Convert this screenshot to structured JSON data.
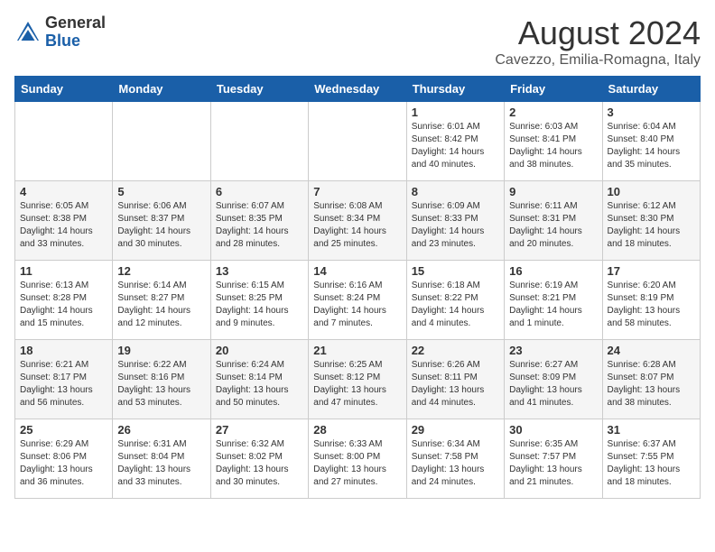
{
  "header": {
    "logo_general": "General",
    "logo_blue": "Blue",
    "month_year": "August 2024",
    "location": "Cavezzo, Emilia-Romagna, Italy"
  },
  "days_of_week": [
    "Sunday",
    "Monday",
    "Tuesday",
    "Wednesday",
    "Thursday",
    "Friday",
    "Saturday"
  ],
  "weeks": [
    [
      {
        "day": "",
        "info": ""
      },
      {
        "day": "",
        "info": ""
      },
      {
        "day": "",
        "info": ""
      },
      {
        "day": "",
        "info": ""
      },
      {
        "day": "1",
        "info": "Sunrise: 6:01 AM\nSunset: 8:42 PM\nDaylight: 14 hours\nand 40 minutes."
      },
      {
        "day": "2",
        "info": "Sunrise: 6:03 AM\nSunset: 8:41 PM\nDaylight: 14 hours\nand 38 minutes."
      },
      {
        "day": "3",
        "info": "Sunrise: 6:04 AM\nSunset: 8:40 PM\nDaylight: 14 hours\nand 35 minutes."
      }
    ],
    [
      {
        "day": "4",
        "info": "Sunrise: 6:05 AM\nSunset: 8:38 PM\nDaylight: 14 hours\nand 33 minutes."
      },
      {
        "day": "5",
        "info": "Sunrise: 6:06 AM\nSunset: 8:37 PM\nDaylight: 14 hours\nand 30 minutes."
      },
      {
        "day": "6",
        "info": "Sunrise: 6:07 AM\nSunset: 8:35 PM\nDaylight: 14 hours\nand 28 minutes."
      },
      {
        "day": "7",
        "info": "Sunrise: 6:08 AM\nSunset: 8:34 PM\nDaylight: 14 hours\nand 25 minutes."
      },
      {
        "day": "8",
        "info": "Sunrise: 6:09 AM\nSunset: 8:33 PM\nDaylight: 14 hours\nand 23 minutes."
      },
      {
        "day": "9",
        "info": "Sunrise: 6:11 AM\nSunset: 8:31 PM\nDaylight: 14 hours\nand 20 minutes."
      },
      {
        "day": "10",
        "info": "Sunrise: 6:12 AM\nSunset: 8:30 PM\nDaylight: 14 hours\nand 18 minutes."
      }
    ],
    [
      {
        "day": "11",
        "info": "Sunrise: 6:13 AM\nSunset: 8:28 PM\nDaylight: 14 hours\nand 15 minutes."
      },
      {
        "day": "12",
        "info": "Sunrise: 6:14 AM\nSunset: 8:27 PM\nDaylight: 14 hours\nand 12 minutes."
      },
      {
        "day": "13",
        "info": "Sunrise: 6:15 AM\nSunset: 8:25 PM\nDaylight: 14 hours\nand 9 minutes."
      },
      {
        "day": "14",
        "info": "Sunrise: 6:16 AM\nSunset: 8:24 PM\nDaylight: 14 hours\nand 7 minutes."
      },
      {
        "day": "15",
        "info": "Sunrise: 6:18 AM\nSunset: 8:22 PM\nDaylight: 14 hours\nand 4 minutes."
      },
      {
        "day": "16",
        "info": "Sunrise: 6:19 AM\nSunset: 8:21 PM\nDaylight: 14 hours\nand 1 minute."
      },
      {
        "day": "17",
        "info": "Sunrise: 6:20 AM\nSunset: 8:19 PM\nDaylight: 13 hours\nand 58 minutes."
      }
    ],
    [
      {
        "day": "18",
        "info": "Sunrise: 6:21 AM\nSunset: 8:17 PM\nDaylight: 13 hours\nand 56 minutes."
      },
      {
        "day": "19",
        "info": "Sunrise: 6:22 AM\nSunset: 8:16 PM\nDaylight: 13 hours\nand 53 minutes."
      },
      {
        "day": "20",
        "info": "Sunrise: 6:24 AM\nSunset: 8:14 PM\nDaylight: 13 hours\nand 50 minutes."
      },
      {
        "day": "21",
        "info": "Sunrise: 6:25 AM\nSunset: 8:12 PM\nDaylight: 13 hours\nand 47 minutes."
      },
      {
        "day": "22",
        "info": "Sunrise: 6:26 AM\nSunset: 8:11 PM\nDaylight: 13 hours\nand 44 minutes."
      },
      {
        "day": "23",
        "info": "Sunrise: 6:27 AM\nSunset: 8:09 PM\nDaylight: 13 hours\nand 41 minutes."
      },
      {
        "day": "24",
        "info": "Sunrise: 6:28 AM\nSunset: 8:07 PM\nDaylight: 13 hours\nand 38 minutes."
      }
    ],
    [
      {
        "day": "25",
        "info": "Sunrise: 6:29 AM\nSunset: 8:06 PM\nDaylight: 13 hours\nand 36 minutes."
      },
      {
        "day": "26",
        "info": "Sunrise: 6:31 AM\nSunset: 8:04 PM\nDaylight: 13 hours\nand 33 minutes."
      },
      {
        "day": "27",
        "info": "Sunrise: 6:32 AM\nSunset: 8:02 PM\nDaylight: 13 hours\nand 30 minutes."
      },
      {
        "day": "28",
        "info": "Sunrise: 6:33 AM\nSunset: 8:00 PM\nDaylight: 13 hours\nand 27 minutes."
      },
      {
        "day": "29",
        "info": "Sunrise: 6:34 AM\nSunset: 7:58 PM\nDaylight: 13 hours\nand 24 minutes."
      },
      {
        "day": "30",
        "info": "Sunrise: 6:35 AM\nSunset: 7:57 PM\nDaylight: 13 hours\nand 21 minutes."
      },
      {
        "day": "31",
        "info": "Sunrise: 6:37 AM\nSunset: 7:55 PM\nDaylight: 13 hours\nand 18 minutes."
      }
    ]
  ]
}
